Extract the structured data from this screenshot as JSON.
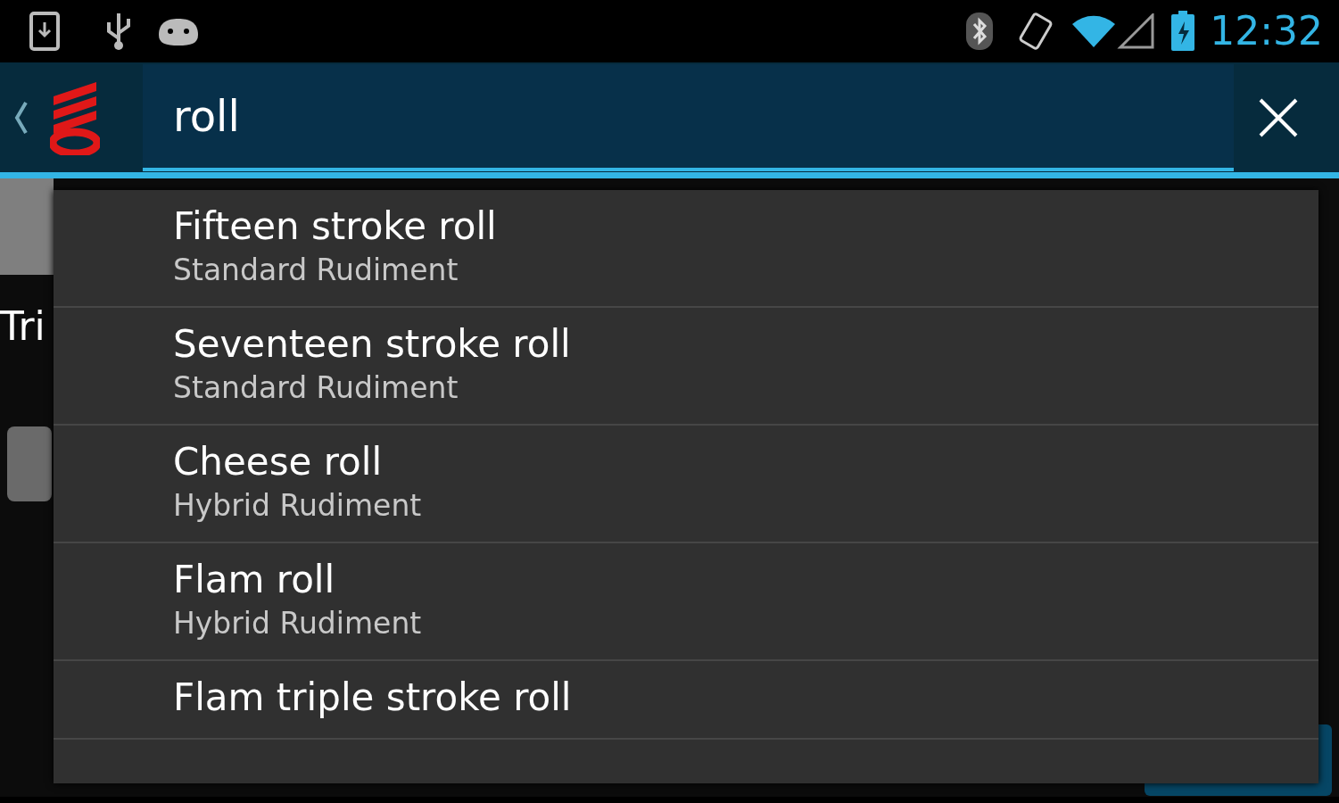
{
  "status_bar": {
    "time": "12:32"
  },
  "search": {
    "query": "roll"
  },
  "background": {
    "text": "Tri"
  },
  "suggestions": [
    {
      "title": "Fifteen stroke roll",
      "subtitle": "Standard Rudiment"
    },
    {
      "title": "Seventeen stroke roll",
      "subtitle": "Standard Rudiment"
    },
    {
      "title": "Cheese roll",
      "subtitle": "Hybrid Rudiment"
    },
    {
      "title": "Flam roll",
      "subtitle": "Hybrid Rudiment"
    },
    {
      "title": "Flam triple stroke roll"
    }
  ]
}
